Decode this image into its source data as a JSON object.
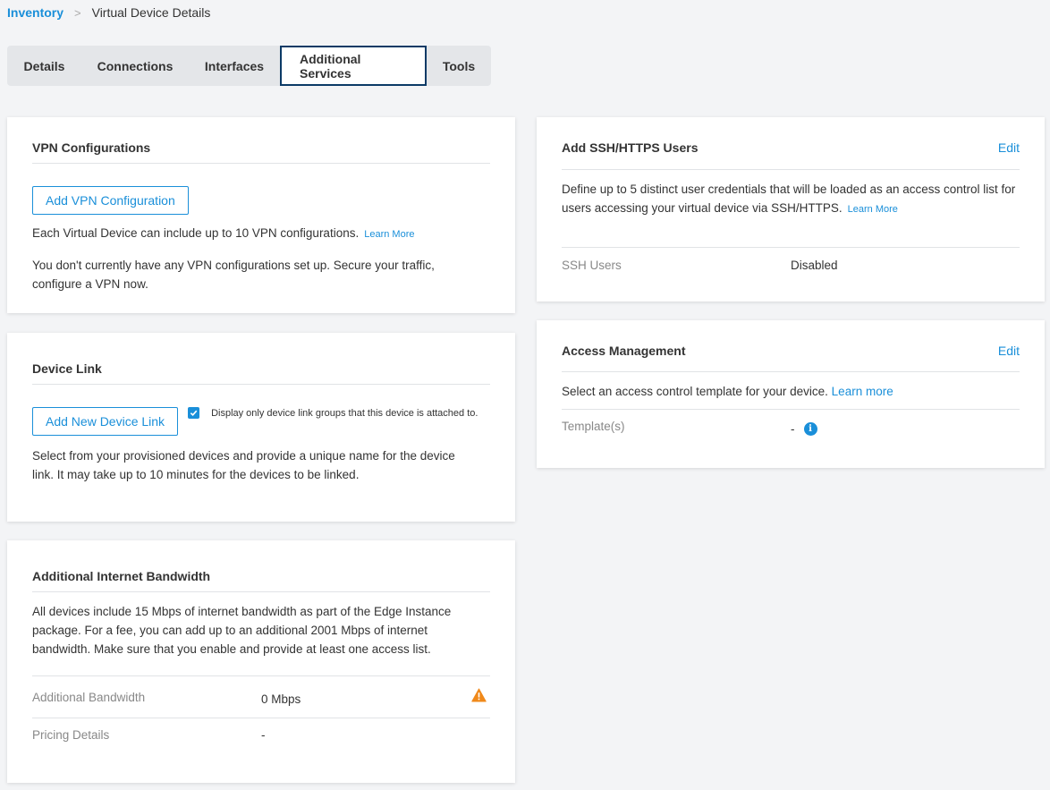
{
  "breadcrumb": {
    "root": "Inventory",
    "separator": ">",
    "current": "Virtual Device Details"
  },
  "tabs": [
    {
      "label": "Details"
    },
    {
      "label": "Connections"
    },
    {
      "label": "Interfaces"
    },
    {
      "label": "Additional Services",
      "active": true
    },
    {
      "label": "Tools"
    }
  ],
  "vpn": {
    "title": "VPN Configurations",
    "button": "Add VPN Configuration",
    "info": "Each Virtual Device can include up to 10 VPN configurations.",
    "learn_more": "Learn More",
    "empty": "You don't currently have any VPN configurations set up. Secure your traffic, configure a VPN now."
  },
  "device_link": {
    "title": "Device Link",
    "button": "Add New Device Link",
    "checkbox_label": "Display only device link groups that this device is attached to.",
    "checkbox_checked": true,
    "description": "Select from your provisioned devices and provide a unique name for the device link. It may take up to 10 minutes for the devices to be linked."
  },
  "bandwidth": {
    "title": "Additional Internet Bandwidth",
    "description": "All devices include 15 Mbps of internet bandwidth as part of the Edge Instance package. For a fee, you can add up to an additional 2001 Mbps of internet bandwidth. Make sure that you enable and provide at least one access list.",
    "rows": [
      {
        "label": "Additional Bandwidth",
        "value": "0 Mbps"
      },
      {
        "label": "Pricing Details",
        "value": "-"
      }
    ],
    "warning_color": "#f0891a"
  },
  "ssh": {
    "title": "Add SSH/HTTPS Users",
    "edit": "Edit",
    "description": "Define up to 5 distinct user credentials that will be loaded as an access control list for users accessing your virtual device via SSH/HTTPS.",
    "learn_more": "Learn More",
    "row": {
      "label": "SSH Users",
      "value": "Disabled"
    }
  },
  "access": {
    "title": "Access Management",
    "edit": "Edit",
    "description": "Select an access control template for your device.",
    "learn_more": "Learn more",
    "row": {
      "label": "Template(s)",
      "value": "-"
    }
  },
  "colors": {
    "accent": "#1a8fd9",
    "active_tab_border": "#0b3a66",
    "background": "#f3f4f6"
  }
}
